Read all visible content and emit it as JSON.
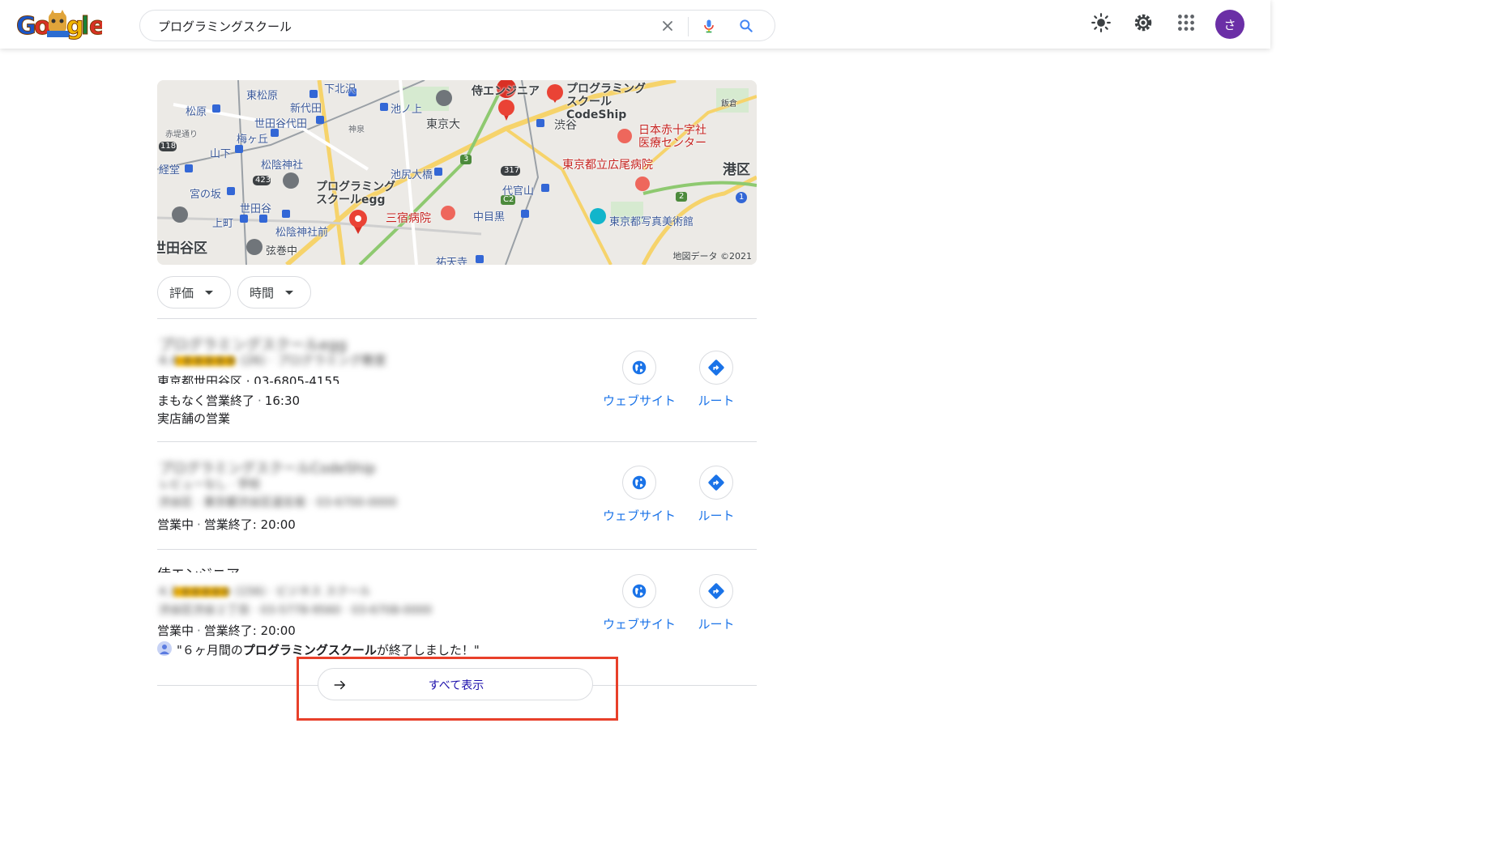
{
  "search": {
    "query": "プログラミングスクール"
  },
  "account": {
    "avatar_initial": "さ"
  },
  "map": {
    "attribution": "地図データ ©2021",
    "labels": {
      "shimokitazawa": "下北沢",
      "higashimatsubara": "東松原",
      "shindaita": "新代田",
      "ikenoue": "池ノ上",
      "matsubara": "松原",
      "setagaya_daita": "世田谷代田",
      "umegaoka": "梅ヶ丘",
      "akatsutsumi": "赤堤通り",
      "yamashita": "山下",
      "shoin_jinja": "松陰神社",
      "kyodo": "経堂",
      "miyanosaka": "宮の坂",
      "setagaya": "世田谷",
      "kamimachi": "上町",
      "shoin_jinjamae": "松陰神社前",
      "setagaya_ward": "世田谷区",
      "gengenaka": "弦巻中",
      "ikejiri_ohashi": "池尻大橋",
      "todai": "東京大",
      "samurai_engineer": "侍エンジニア",
      "codeship": "プログラミング スクールCodeShip",
      "shibuya": "渋谷",
      "iikura": "飯倉",
      "red_cross": "日本赤十字社 医療センター",
      "hiroo_hospital": "東京都立広尾病院",
      "minato_ward": "港区",
      "prog_egg": "プログラミング スクールegg",
      "sanshuku_hospital": "三宿病院",
      "daikanyama": "代官山",
      "nakameguro": "中目黒",
      "photo_museum": "東京都写真美術館",
      "yutenji": "祐天寺",
      "shinsen": "神泉",
      "route_118": "118",
      "route_423": "423",
      "route_317": "317",
      "route_3": "3",
      "route_2": "2",
      "route_1": "1",
      "route_c2": "C2"
    }
  },
  "filters": [
    {
      "label": "評価"
    },
    {
      "label": "時間"
    }
  ],
  "results": [
    {
      "name_blurred": "プログラミングスクールegg",
      "rating_blurred": "4.4 ★★★★★ (26) · プログラミング教室",
      "address": "東京都世田谷区 · 03-6805-4155",
      "status": "まもなく営業終了",
      "status_time": "16:30",
      "extra": "実店舗の営業",
      "website_label": "ウェブサイト",
      "route_label": "ルート"
    },
    {
      "name_blurred": "プログラミングスクールCodeShip",
      "rating_blurred": "レビューなし · 学校",
      "address_blurred": "渋谷区 · 東京都渋谷区道玄坂 · 03-6700-0000",
      "status": "営業中",
      "status_time": "営業終了: 20:00",
      "website_label": "ウェブサイト",
      "route_label": "ルート"
    },
    {
      "name": "侍エンジニア",
      "rating_blurred": "4.3 ★★★★★ (156) · ビジネス スクール",
      "address_blurred": "渋谷区渋谷２丁目 · 03-5778-9560 · 03-6708-0000",
      "status": "営業中",
      "status_time": "営業終了: 20:00",
      "review_prefix": "\"６ヶ月間の",
      "review_bold": "プログラミングスクール",
      "review_suffix": "が終了しました！\"",
      "website_label": "ウェブサイト",
      "route_label": "ルート"
    }
  ],
  "show_all": {
    "label": "すべて表示"
  },
  "colors": {
    "accent": "#1a73e8",
    "highlight_border": "#e8402a",
    "status_orange": "#b06000",
    "avatar_bg": "#6b2fa6"
  }
}
